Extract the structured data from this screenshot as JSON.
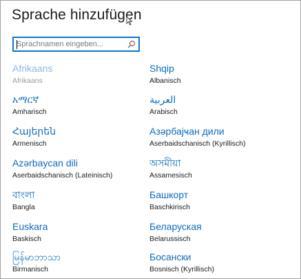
{
  "dialog": {
    "title": "Sprache hinzufügen",
    "search": {
      "placeholder": "Sprachnamen eingeben...",
      "value": ""
    }
  },
  "languages": [
    {
      "native": "Afrikaans",
      "german": "Afrikaans",
      "disabled": true
    },
    {
      "native": "Shqip",
      "german": "Albanisch",
      "disabled": false
    },
    {
      "native": "አማርኛ",
      "german": "Amharisch",
      "disabled": false
    },
    {
      "native": "العربية",
      "german": "Arabisch",
      "disabled": false
    },
    {
      "native": "Հայերեն",
      "german": "Armenisch",
      "disabled": false
    },
    {
      "native": "Азәрбајҹан дили",
      "german": "Aserbaidschanisch (Kyrillisch)",
      "disabled": false
    },
    {
      "native": "Azərbaycan dili",
      "german": "Aserbaidschanisch (Lateinisch)",
      "disabled": false
    },
    {
      "native": "অসমীয়া",
      "german": "Assamesisch",
      "disabled": false
    },
    {
      "native": "বাংলা",
      "german": "Bangla",
      "disabled": false
    },
    {
      "native": "Башкорт",
      "german": "Baschkirisch",
      "disabled": false
    },
    {
      "native": "Euskara",
      "german": "Baskisch",
      "disabled": false
    },
    {
      "native": "Беларуская",
      "german": "Belarussisch",
      "disabled": false
    },
    {
      "native": "မြန်မာဘာသာ",
      "german": "Birmanisch",
      "disabled": false
    },
    {
      "native": "Босански",
      "german": "Bosnisch (Kyrillisch)",
      "disabled": false
    }
  ],
  "colors": {
    "accent": "#0b74d4",
    "language_link": "#0b6cbd",
    "disabled_link": "#8fb8dd"
  }
}
